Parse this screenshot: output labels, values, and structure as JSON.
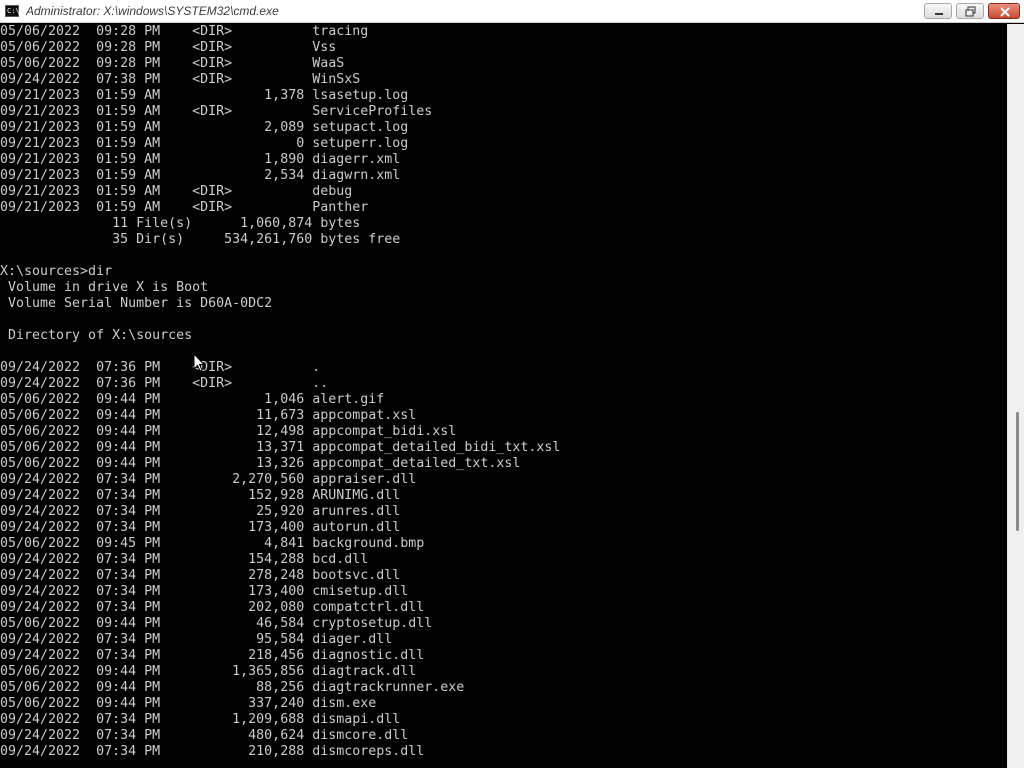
{
  "window": {
    "title": "Administrator: X:\\windows\\SYSTEM32\\cmd.exe",
    "icon": "cmd-icon"
  },
  "console": {
    "lines": [
      "05/06/2022  09:28 PM    <DIR>          tracing",
      "05/06/2022  09:28 PM    <DIR>          Vss",
      "05/06/2022  09:28 PM    <DIR>          WaaS",
      "09/24/2022  07:38 PM    <DIR>          WinSxS",
      "09/21/2023  01:59 AM             1,378 lsasetup.log",
      "09/21/2023  01:59 AM    <DIR>          ServiceProfiles",
      "09/21/2023  01:59 AM             2,089 setupact.log",
      "09/21/2023  01:59 AM                 0 setuperr.log",
      "09/21/2023  01:59 AM             1,890 diagerr.xml",
      "09/21/2023  01:59 AM             2,534 diagwrn.xml",
      "09/21/2023  01:59 AM    <DIR>          debug",
      "09/21/2023  01:59 AM    <DIR>          Panther",
      "              11 File(s)      1,060,874 bytes",
      "              35 Dir(s)     534,261,760 bytes free",
      "",
      "X:\\sources>dir",
      " Volume in drive X is Boot",
      " Volume Serial Number is D60A-0DC2",
      "",
      " Directory of X:\\sources",
      "",
      "09/24/2022  07:36 PM    <DIR>          .",
      "09/24/2022  07:36 PM    <DIR>          ..",
      "05/06/2022  09:44 PM             1,046 alert.gif",
      "05/06/2022  09:44 PM            11,673 appcompat.xsl",
      "05/06/2022  09:44 PM            12,498 appcompat_bidi.xsl",
      "05/06/2022  09:44 PM            13,371 appcompat_detailed_bidi_txt.xsl",
      "05/06/2022  09:44 PM            13,326 appcompat_detailed_txt.xsl",
      "09/24/2022  07:34 PM         2,270,560 appraiser.dll",
      "09/24/2022  07:34 PM           152,928 ARUNIMG.dll",
      "09/24/2022  07:34 PM            25,920 arunres.dll",
      "09/24/2022  07:34 PM           173,400 autorun.dll",
      "05/06/2022  09:45 PM             4,841 background.bmp",
      "09/24/2022  07:34 PM           154,288 bcd.dll",
      "09/24/2022  07:34 PM           278,248 bootsvc.dll",
      "09/24/2022  07:34 PM           173,400 cmisetup.dll",
      "09/24/2022  07:34 PM           202,080 compatctrl.dll",
      "05/06/2022  09:44 PM            46,584 cryptosetup.dll",
      "09/24/2022  07:34 PM            95,584 diager.dll",
      "09/24/2022  07:34 PM           218,456 diagnostic.dll",
      "05/06/2022  09:44 PM         1,365,856 diagtrack.dll",
      "05/06/2022  09:44 PM            88,256 diagtrackrunner.exe",
      "05/06/2022  09:44 PM           337,240 dism.exe",
      "09/24/2022  07:34 PM         1,209,688 dismapi.dll",
      "09/24/2022  07:34 PM           480,624 dismcore.dll",
      "09/24/2022  07:34 PM           210,288 dismcoreps.dll"
    ]
  },
  "scrollbar": {
    "position": 0.62,
    "visible_fraction": 0.16
  },
  "colors": {
    "console_bg": "#000000",
    "console_fg": "#cccccc",
    "titlebar_bg": "#ffffff",
    "close_button": "#c94a33"
  }
}
